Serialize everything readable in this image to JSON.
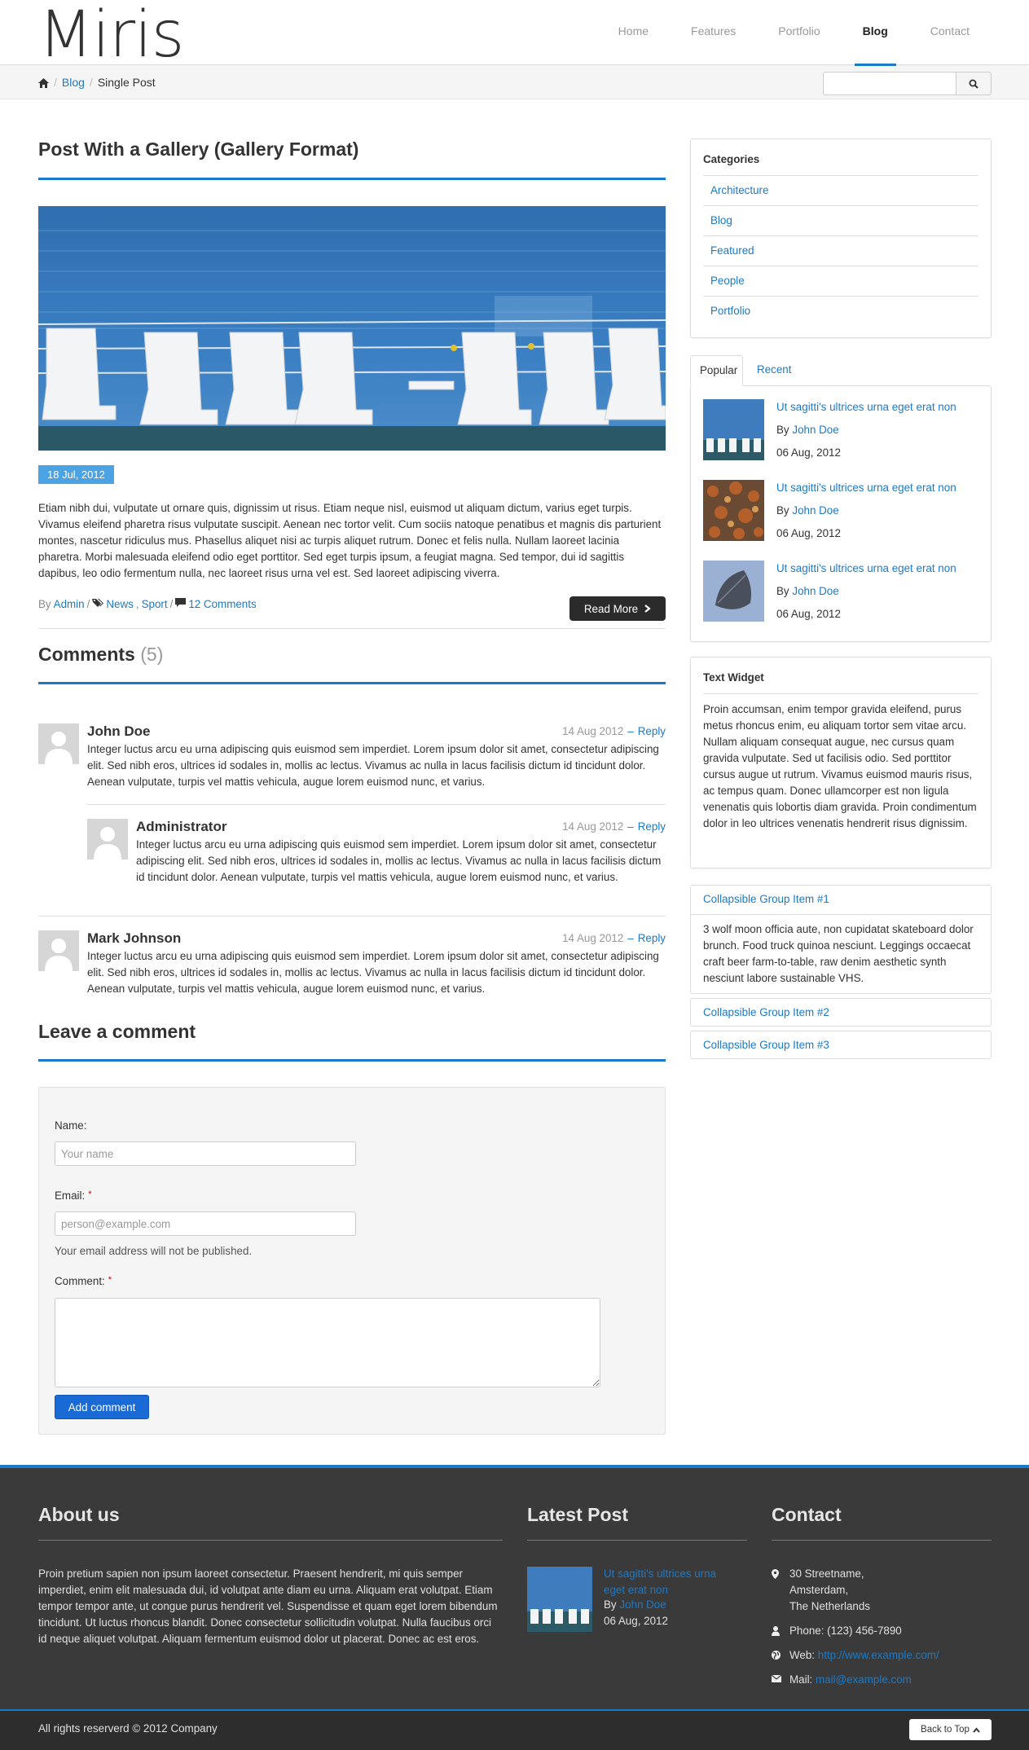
{
  "site": {
    "logo": "Miris"
  },
  "nav": [
    {
      "label": "Home"
    },
    {
      "label": "Features"
    },
    {
      "label": "Portfolio"
    },
    {
      "label": "Blog",
      "active": true
    },
    {
      "label": "Contact"
    }
  ],
  "breadcrumb": {
    "blog": "Blog",
    "current": "Single Post"
  },
  "search": {
    "placeholder": ""
  },
  "post": {
    "title": "Post With a Gallery (Gallery Format)",
    "date": "18 Jul, 2012",
    "body": "Etiam nibh dui, vulputate ut ornare quis, dignissim ut risus. Etiam neque nisl, euismod ut aliquam dictum, varius eget turpis. Vivamus eleifend pharetra risus vulputate suscipit. Aenean nec tortor velit. Cum sociis natoque penatibus et magnis dis parturient montes, nascetur ridiculus mus. Phasellus aliquet nisi ac turpis aliquet rutrum. Donec et felis nulla. Nullam laoreet lacinia pharetra. Morbi malesuada eleifend odio eget porttitor. Sed eget turpis ipsum, a feugiat magna. Sed tempor, dui id sagittis dapibus, leo odio fermentum nulla, nec laoreet risus urna vel est. Sed laoreet adipiscing viverra.",
    "meta": {
      "by": "By",
      "author": "Admin",
      "sep": "/",
      "tag1": "News",
      "tag2": "Sport",
      "comments": "12 Comments"
    },
    "read_more": "Read More"
  },
  "comments": {
    "title": "Comments",
    "count": "(5)",
    "items": [
      {
        "author": "John Doe",
        "date": "14 Aug 2012",
        "dash": "–",
        "reply": "Reply",
        "text": "Integer luctus arcu eu urna adipiscing quis euismod sem imperdiet. Lorem ipsum dolor sit amet, consectetur adipiscing elit. Sed nibh eros, ultrices id sodales in, mollis ac lectus. Vivamus ac nulla in lacus facilisis dictum id tincidunt dolor. Aenean vulputate, turpis vel mattis vehicula, augue lorem euismod nunc, et varius."
      },
      {
        "author": "Administrator",
        "date": "14 Aug 2012",
        "dash": "–",
        "reply": "Reply",
        "text": "Integer luctus arcu eu urna adipiscing quis euismod sem imperdiet. Lorem ipsum dolor sit amet, consectetur adipiscing elit. Sed nibh eros, ultrices id sodales in, mollis ac lectus. Vivamus ac nulla in lacus facilisis dictum id tincidunt dolor. Aenean vulputate, turpis vel mattis vehicula, augue lorem euismod nunc, et varius."
      },
      {
        "author": "Mark Johnson",
        "date": "14 Aug 2012",
        "dash": "–",
        "reply": "Reply",
        "text": "Integer luctus arcu eu urna adipiscing quis euismod sem imperdiet. Lorem ipsum dolor sit amet, consectetur adipiscing elit. Sed nibh eros, ultrices id sodales in, mollis ac lectus. Vivamus ac nulla in lacus facilisis dictum id tincidunt dolor. Aenean vulputate, turpis vel mattis vehicula, augue lorem euismod nunc, et varius."
      }
    ]
  },
  "form": {
    "title": "Leave a comment",
    "name_label": "Name:",
    "name_placeholder": "Your name",
    "email_label": "Email:",
    "email_placeholder": "person@example.com",
    "email_note": "Your email address will not be published.",
    "comment_label": "Comment:",
    "required_mark": "*",
    "submit": "Add comment"
  },
  "sidebar": {
    "categories_title": "Categories",
    "categories": [
      "Architecture",
      "Blog",
      "Featured",
      "People",
      "Portfolio"
    ],
    "tabs": {
      "popular": "Popular",
      "recent": "Recent"
    },
    "popular": [
      {
        "title": "Ut sagitti's ultrices urna eget erat non",
        "by": "By",
        "author": "John Doe",
        "date": "06 Aug, 2012"
      },
      {
        "title": "Ut sagitti's ultrices urna eget erat non",
        "by": "By",
        "author": "John Doe",
        "date": "06 Aug, 2012"
      },
      {
        "title": "Ut sagitti's ultrices urna eget erat non",
        "by": "By",
        "author": "John Doe",
        "date": "06 Aug, 2012"
      }
    ],
    "text_widget_title": "Text Widget",
    "text_widget": "Proin accumsan, enim tempor gravida eleifend, purus metus rhoncus enim, eu aliquam tortor sem vitae arcu. Nullam aliquam consequat augue, nec cursus quam gravida vulputate. Sed ut facilisis odio. Sed porttitor cursus augue ut rutrum. Vivamus euismod mauris risus, ac tempus quam. Donec ullamcorper est non ligula venenatis quis lobortis diam gravida. Proin condimentum dolor in leo ultrices venenatis hendrerit risus dignissim.",
    "accordion": [
      {
        "title": "Collapsible Group Item #1",
        "body": "3 wolf moon officia aute, non cupidatat skateboard dolor brunch. Food truck quinoa nesciunt. Leggings occaecat craft beer farm-to-table, raw denim aesthetic synth nesciunt labore sustainable VHS."
      },
      {
        "title": "Collapsible Group Item #2"
      },
      {
        "title": "Collapsible Group Item #3"
      }
    ]
  },
  "footer": {
    "about_title": "About us",
    "about_text": "Proin pretium sapien non ipsum laoreet consectetur. Praesent hendrerit, mi quis semper imperdiet, enim elit malesuada dui, id volutpat ante diam eu urna. Aliquam erat volutpat. Etiam tempor tempor ante, ut congue purus hendrerit vel. Suspendisse et quam eget lorem bibendum tincidunt. Ut luctus rhoncus blandit. Donec consectetur sollicitudin volutpat. Nulla faucibus orci id neque aliquet volutpat. Aliquam fermentum euismod dolor ut placerat. Donec ac est eros.",
    "latest_title": "Latest Post",
    "latest": {
      "title": "Ut sagitti's ultrices urna eget erat non",
      "by": "By",
      "author": "John Doe",
      "date": "06 Aug, 2012"
    },
    "contact_title": "Contact",
    "address": [
      "30 Streetname,",
      "Amsterdam,",
      "The Netherlands"
    ],
    "phone": "Phone: (123) 456-7890",
    "web_label": "Web:",
    "web": "http://www.example.com/",
    "mail_label": "Mail:",
    "mail": "mail@example.com",
    "copyright": "All rights reserverd © 2012 Company",
    "back_to_top": "Back to Top"
  },
  "colors": {
    "accent": "#1a7ac9",
    "footer_bg": "#3a3a3a",
    "bottom_bg": "#2d2d2d",
    "date_badge": "#4ba3e3"
  }
}
